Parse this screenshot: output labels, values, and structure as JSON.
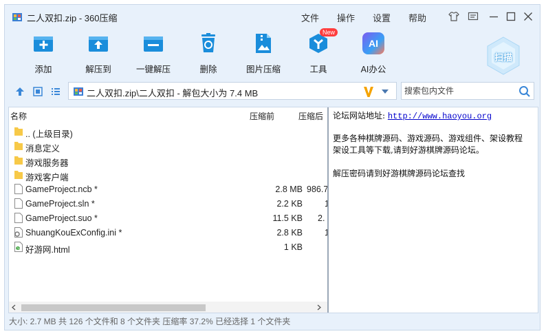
{
  "window": {
    "title": "二人双扣.zip - 360压缩",
    "menus": [
      "文件",
      "操作",
      "设置",
      "帮助"
    ]
  },
  "toolbar": {
    "items": [
      {
        "label": "添加",
        "icon": "add-icon"
      },
      {
        "label": "解压到",
        "icon": "extract-to-icon"
      },
      {
        "label": "一键解压",
        "icon": "one-click-extract-icon"
      },
      {
        "label": "删除",
        "icon": "delete-icon"
      },
      {
        "label": "图片压缩",
        "icon": "image-compress-icon"
      },
      {
        "label": "工具",
        "icon": "tools-icon",
        "badge": "New"
      },
      {
        "label": "AI办公",
        "icon": "ai-office-icon",
        "icon_text": "AI"
      }
    ],
    "scan_label": "扫描"
  },
  "address": {
    "path": "二人双扣.zip\\二人双扣 - 解包大小为 7.4 MB",
    "search_placeholder": "搜索包内文件"
  },
  "list": {
    "columns": [
      "名称",
      "压缩前",
      "压缩后"
    ],
    "rows": [
      {
        "name": ".. (上级目录)",
        "type": "folder",
        "size": "",
        "packed": ""
      },
      {
        "name": "消息定义",
        "type": "folder",
        "size": "",
        "packed": ""
      },
      {
        "name": "游戏服务器",
        "type": "folder",
        "size": "",
        "packed": ""
      },
      {
        "name": "游戏客户端",
        "type": "folder",
        "size": "",
        "packed": ""
      },
      {
        "name": "GameProject.ncb *",
        "type": "file",
        "size": "2.8 MB",
        "packed": "986.7"
      },
      {
        "name": "GameProject.sln *",
        "type": "file",
        "size": "2.2 KB",
        "packed": "1"
      },
      {
        "name": "GameProject.suo *",
        "type": "file",
        "size": "11.5 KB",
        "packed": "2."
      },
      {
        "name": "ShuangKouExConfig.ini *",
        "type": "config",
        "size": "2.8 KB",
        "packed": "1"
      },
      {
        "name": "好游网.html",
        "type": "html",
        "size": "1 KB",
        "packed": ""
      }
    ]
  },
  "comment": {
    "line1_label": "论坛网站地址: ",
    "line1_link": "http://www.haoyou.org",
    "line2": "更多各种棋牌源码、游戏源码、游戏组件、架设教程",
    "line3": "架设工具等下载,请到好游棋牌源码论坛。",
    "line4": "解压密码请到好游棋牌源码论坛查找"
  },
  "status": "大小: 2.7 MB 共 126 个文件和 8 个文件夹 压缩率 37.2% 已经选择 1 个文件夹",
  "colors": {
    "accent": "#1a8ddb",
    "window_bg": "#e8f1fb",
    "folder": "#f7c948"
  }
}
